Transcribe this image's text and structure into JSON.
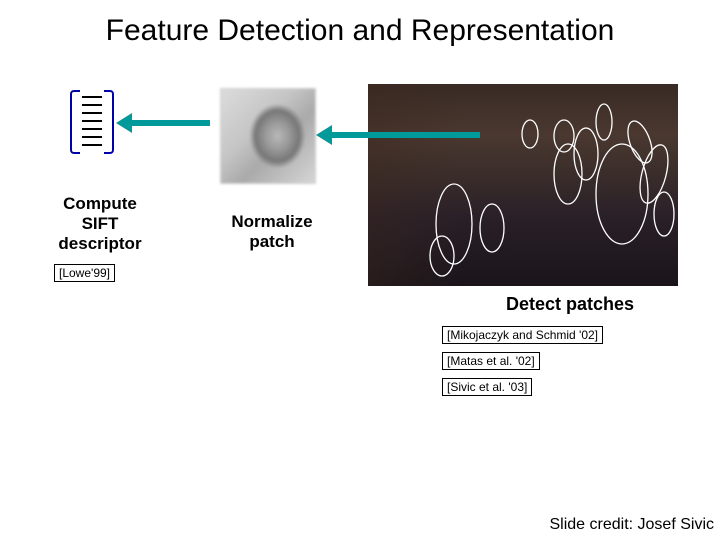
{
  "title": "Feature Detection and Representation",
  "stages": {
    "sift": {
      "label": "Compute\nSIFT\ndescriptor",
      "cite": "[Lowe'99]"
    },
    "normalize": {
      "label": "Normalize\npatch"
    },
    "detect": {
      "label": "Detect patches",
      "cites": [
        "[Mikojaczyk and Schmid '02]",
        "[Matas et al. '02]",
        "[Sivic et al. '03]"
      ]
    }
  },
  "credit": "Slide credit: Josef Sivic"
}
